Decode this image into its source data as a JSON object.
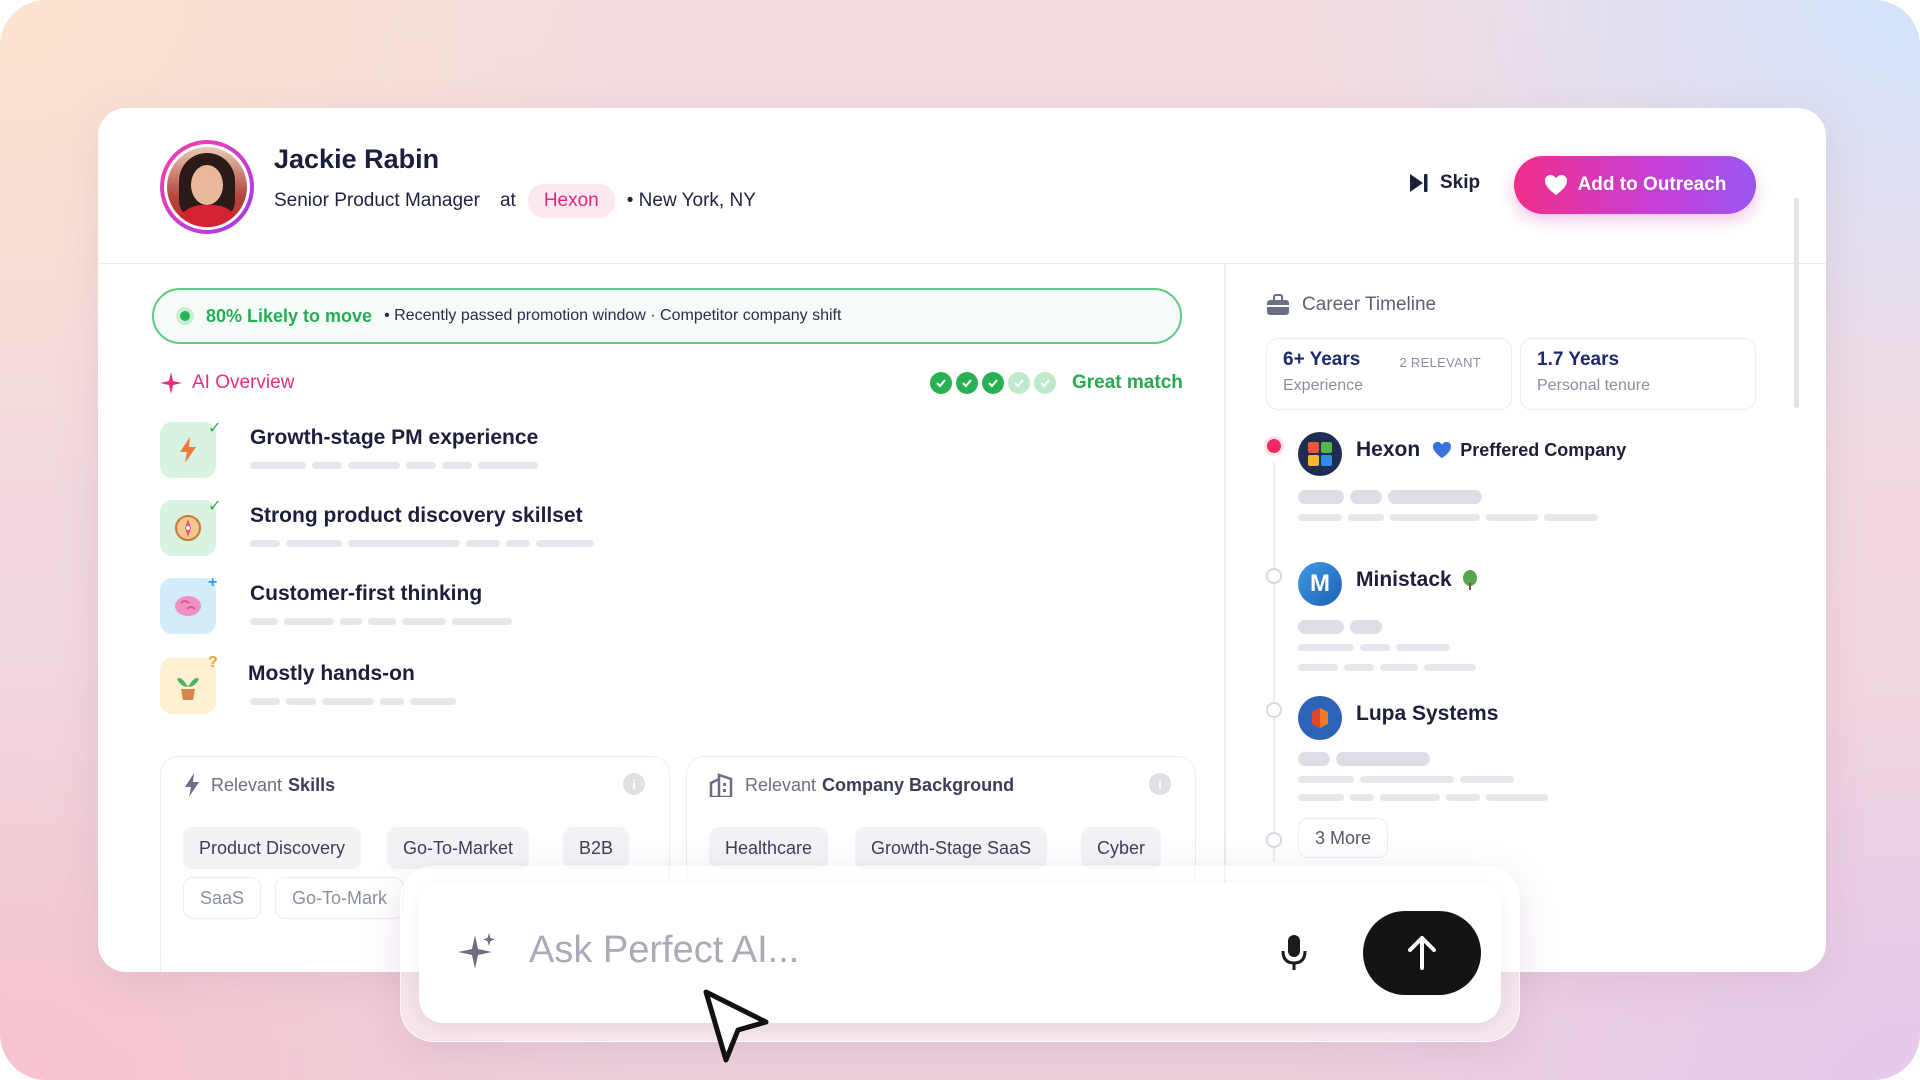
{
  "profile": {
    "name": "Jackie Rabin",
    "title": "Senior Product Manager",
    "at": "at",
    "company": "Hexon",
    "location": "• New York, NY"
  },
  "actions": {
    "skip_label": "Skip",
    "outreach_label": "Add to Outreach"
  },
  "move": {
    "likely": "80% Likely to move",
    "reasons": "• Recently passed promotion window · Competitor company shift"
  },
  "ai_overview": {
    "label": "AI Overview",
    "match_label": "Great match",
    "match_score": 3,
    "match_max": 5,
    "items": [
      {
        "title": "Growth-stage PM experience",
        "badge": "✓"
      },
      {
        "title": "Strong product discovery skillset",
        "badge": "✓"
      },
      {
        "title": "Customer-first thinking",
        "badge": "+"
      },
      {
        "title": "Mostly hands-on",
        "badge": "?"
      }
    ]
  },
  "skills_panel": {
    "title_prefix": "Relevant",
    "title_bold": "Skills",
    "info": "i",
    "chips": [
      "Product Discovery",
      "Go-To-Market",
      "B2B",
      "SaaS",
      "Go-To-Mark"
    ]
  },
  "company_panel": {
    "title_prefix": "Relevant",
    "title_bold": "Company Background",
    "info": "i",
    "chips": [
      "Healthcare",
      "Growth-Stage SaaS",
      "Cyber"
    ]
  },
  "career": {
    "title": "Career Timeline",
    "stats": [
      {
        "big": "6+ Years",
        "small": "Experience",
        "tag": "2 RELEVANT"
      },
      {
        "big": "1.7 Years",
        "small": "Personal tenure"
      }
    ],
    "companies": [
      {
        "name": "Hexon",
        "tag": "Preffered Company"
      },
      {
        "name": "Ministack"
      },
      {
        "name": "Lupa Systems"
      }
    ],
    "more_label": "3 More"
  },
  "ask": {
    "placeholder": "Ask Perfect AI..."
  },
  "colors": {
    "accent_pink": "#ea2b7b",
    "success_green": "#27b152",
    "brand_gradient_start": "#f02d8a",
    "brand_gradient_end": "#9a56f2"
  }
}
